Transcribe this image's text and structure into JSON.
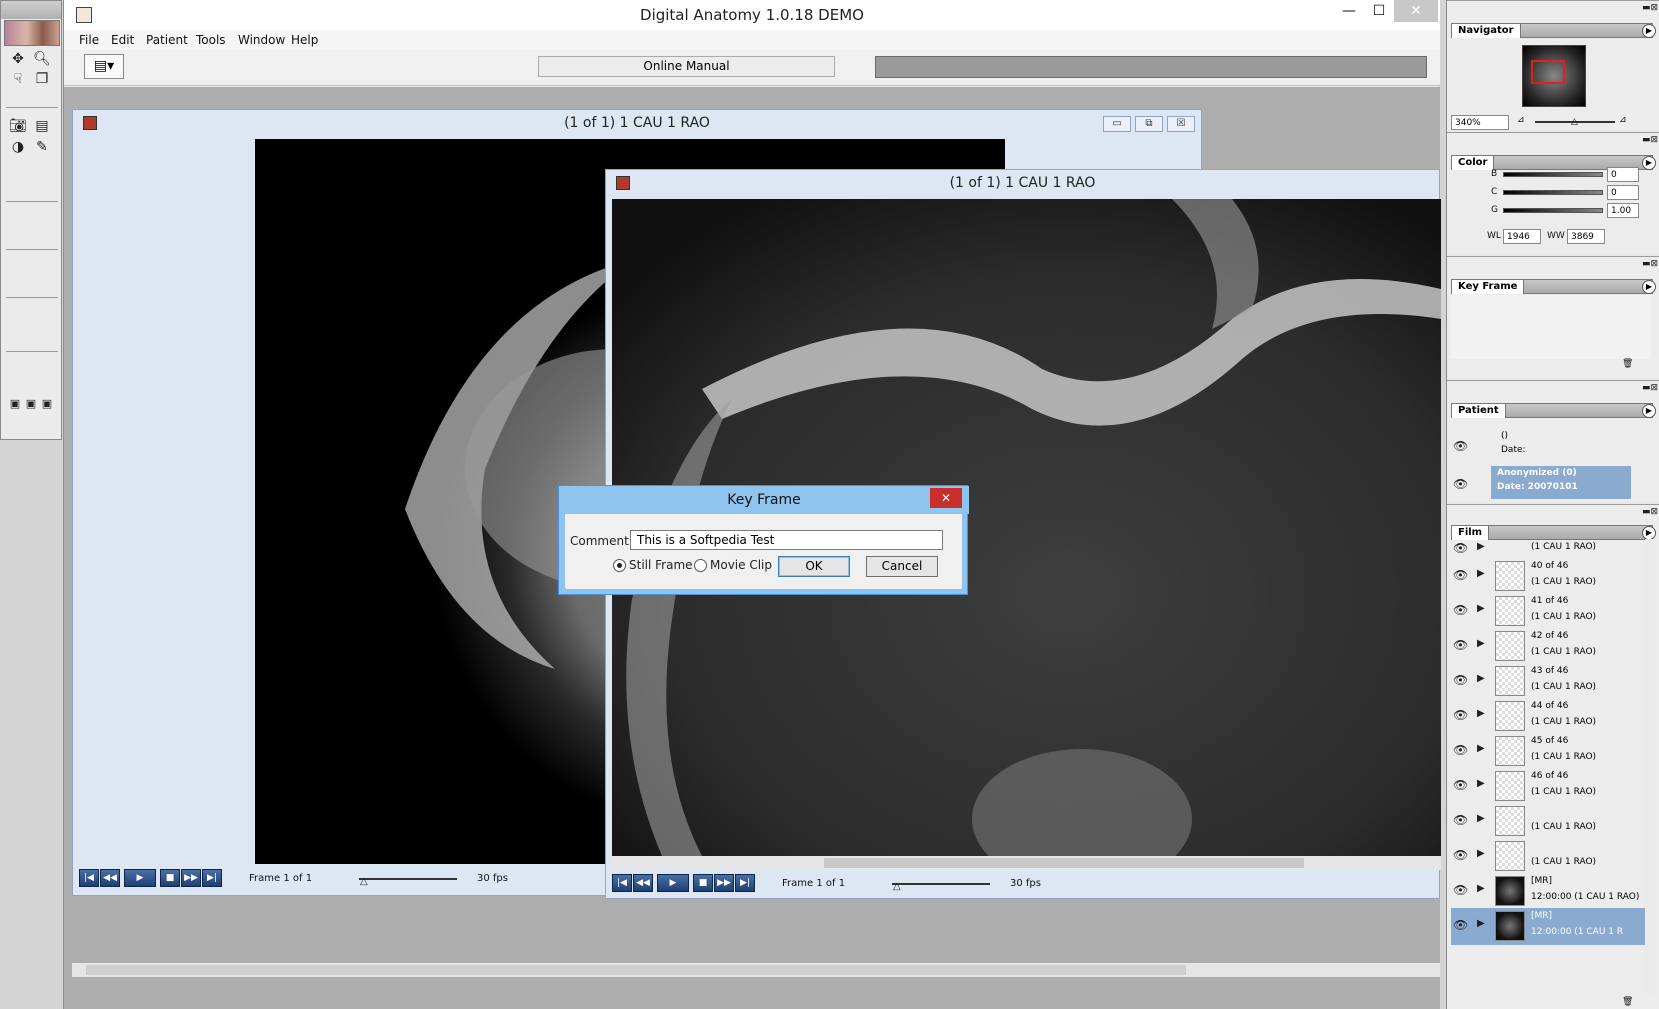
{
  "app": {
    "title": "Digital Anatomy 1.0.18 DEMO",
    "online_manual": "Online Manual"
  },
  "menu": [
    "File",
    "Edit",
    "Patient",
    "Tools",
    "Window",
    "Help"
  ],
  "window_controls": {
    "minimize": "—",
    "maximize": "☐",
    "close": "✕"
  },
  "viewer_back": {
    "title": "(1 of 1) 1 CAU 1 RAO",
    "frame": "Frame 1 of 1",
    "fps": "30 fps"
  },
  "viewer_front": {
    "title": "(1 of 1) 1 CAU 1 RAO",
    "frame": "Frame 1 of 1",
    "fps": "30 fps"
  },
  "dialog": {
    "title": "Key Frame",
    "comment_label": "Comment",
    "comment_value": "This is a Softpedia Test",
    "still_frame": "Still Frame",
    "movie_clip": "Movie Clip",
    "ok": "OK",
    "cancel": "Cancel",
    "selected": "still_frame"
  },
  "navigator": {
    "tab": "Navigator",
    "zoom": "340%"
  },
  "color": {
    "tab": "Color",
    "b_label": "B",
    "b_value": "0",
    "c_label": "C",
    "c_value": "0",
    "g_label": "G",
    "g_value": "1.00",
    "wl_label": "WL",
    "wl_value": "1946",
    "ww_label": "WW",
    "ww_value": "3869"
  },
  "key_frame_panel": {
    "tab": "Key Frame"
  },
  "patient": {
    "tab": "Patient",
    "row1_l1": "()",
    "row1_l2": "Date:",
    "row2_l1": "Anonymized (0)",
    "row2_l2": "Date: 20070101"
  },
  "film": {
    "tab": "Film",
    "top_partial": "(1 CAU 1 RAO)",
    "rows": [
      {
        "l1": "40 of 46",
        "l2": "(1 CAU 1 RAO)"
      },
      {
        "l1": "41 of 46",
        "l2": "(1 CAU 1 RAO)"
      },
      {
        "l1": "42 of 46",
        "l2": "(1 CAU 1 RAO)"
      },
      {
        "l1": "43 of 46",
        "l2": "(1 CAU 1 RAO)"
      },
      {
        "l1": "44 of 46",
        "l2": "(1 CAU 1 RAO)"
      },
      {
        "l1": "45 of 46",
        "l2": "(1 CAU 1 RAO)"
      },
      {
        "l1": "46 of 46",
        "l2": "(1 CAU 1 RAO)"
      },
      {
        "l1": "",
        "l2": "(1 CAU 1 RAO)"
      },
      {
        "l1": "",
        "l2": "(1 CAU 1 RAO)"
      },
      {
        "l1": "[MR]",
        "l2": "12:00:00 (1 CAU 1 RAO)"
      },
      {
        "l1": "[MR]",
        "l2": "12:00:00 (1 CAU 1 R"
      }
    ]
  }
}
